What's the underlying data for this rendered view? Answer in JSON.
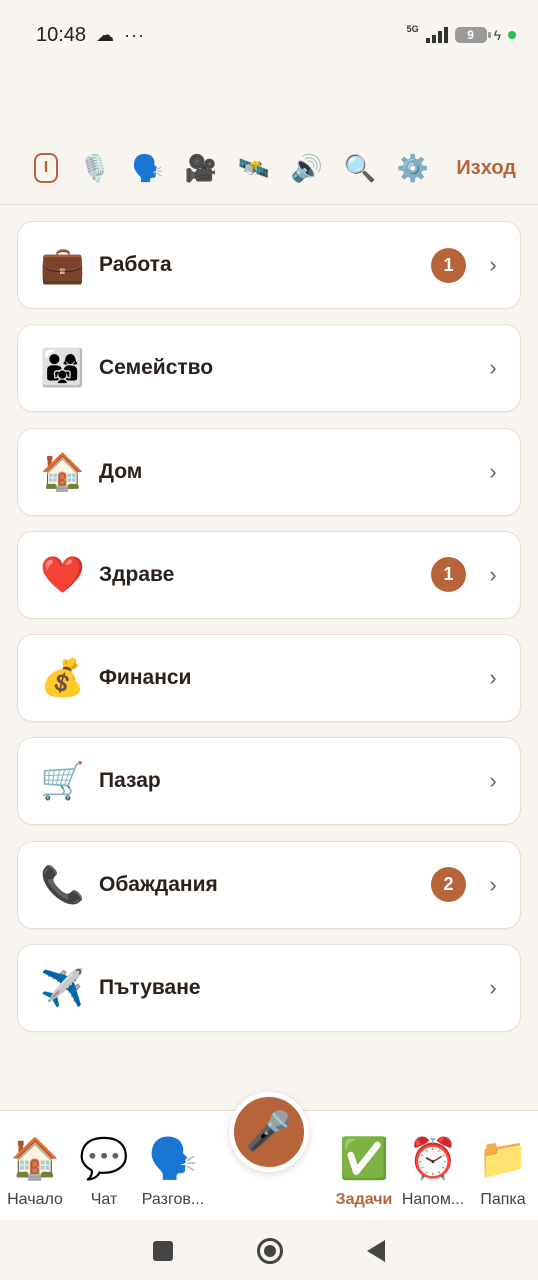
{
  "status_bar": {
    "time": "10:48",
    "cloud_icon": "cloud-icon",
    "notification_dots": "···",
    "network": "5G",
    "battery": "9",
    "bolt": "ϟ"
  },
  "toolbar": {
    "cursor_icon": "I",
    "icons": [
      {
        "name": "microphone-icon",
        "glyph": "🎙️"
      },
      {
        "name": "speaking-head-icon",
        "glyph": "🗣️"
      },
      {
        "name": "movie-camera-icon",
        "glyph": "🎥"
      },
      {
        "name": "satellite-icon",
        "glyph": "🛰️"
      },
      {
        "name": "speaker-icon",
        "glyph": "🔊"
      },
      {
        "name": "magnifier-icon",
        "glyph": "🔍"
      },
      {
        "name": "gear-icon",
        "glyph": "⚙️"
      }
    ],
    "logout_label": "Изход"
  },
  "categories": [
    {
      "label": "Работа",
      "icon": "💼",
      "icon_name": "briefcase-icon",
      "badge": "1"
    },
    {
      "label": "Семейство",
      "icon": "👨‍👩‍👧",
      "icon_name": "family-icon",
      "badge": ""
    },
    {
      "label": "Дом",
      "icon": "🏠",
      "icon_name": "house-icon",
      "badge": ""
    },
    {
      "label": "Здраве",
      "icon": "❤️",
      "icon_name": "heart-icon",
      "badge": "1"
    },
    {
      "label": "Финанси",
      "icon": "💰",
      "icon_name": "money-bag-icon",
      "badge": ""
    },
    {
      "label": "Пазар",
      "icon": "🛒",
      "icon_name": "shopping-cart-icon",
      "badge": ""
    },
    {
      "label": "Обаждания",
      "icon": "📞",
      "icon_name": "telephone-icon",
      "badge": "2"
    },
    {
      "label": "Пътуване",
      "icon": "✈️",
      "icon_name": "airplane-icon",
      "badge": ""
    }
  ],
  "chevron": "›",
  "bottom_nav": {
    "items": [
      {
        "label": "Начало",
        "icon": "🏠",
        "icon_name": "home-icon"
      },
      {
        "label": "Чат",
        "icon": "💬",
        "icon_name": "chat-bubble-icon"
      },
      {
        "label": "Разгов...",
        "icon": "🗣️",
        "icon_name": "speaking-head-icon"
      },
      {
        "label": "Задачи",
        "icon": "✅",
        "icon_name": "check-mark-icon",
        "active": true
      },
      {
        "label": "Напом...",
        "icon": "⏰",
        "icon_name": "alarm-clock-icon"
      },
      {
        "label": "Папка",
        "icon": "📁",
        "icon_name": "folder-icon"
      }
    ],
    "mic_icon": "🎤"
  },
  "colors": {
    "accent": "#b8643a",
    "background": "#f8f4ef",
    "card": "#ffffff",
    "status_green": "#2bbd57"
  }
}
